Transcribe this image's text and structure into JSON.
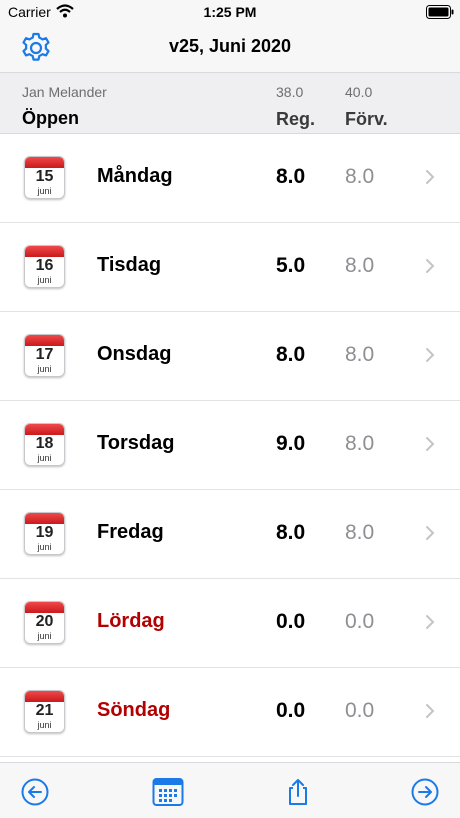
{
  "status_bar": {
    "carrier": "Carrier",
    "time": "1:25 PM"
  },
  "nav": {
    "title": "v25, Juni 2020"
  },
  "header": {
    "user": "Jan Melander",
    "status": "Öppen",
    "reg_total": "38.0",
    "expected_total": "40.0",
    "reg_label": "Reg.",
    "expected_label": "Förv."
  },
  "days": [
    {
      "date": "15",
      "month": "juni",
      "name": "Måndag",
      "reg": "8.0",
      "expected": "8.0",
      "weekend": false
    },
    {
      "date": "16",
      "month": "juni",
      "name": "Tisdag",
      "reg": "5.0",
      "expected": "8.0",
      "weekend": false
    },
    {
      "date": "17",
      "month": "juni",
      "name": "Onsdag",
      "reg": "8.0",
      "expected": "8.0",
      "weekend": false
    },
    {
      "date": "18",
      "month": "juni",
      "name": "Torsdag",
      "reg": "9.0",
      "expected": "8.0",
      "weekend": false
    },
    {
      "date": "19",
      "month": "juni",
      "name": "Fredag",
      "reg": "8.0",
      "expected": "8.0",
      "weekend": false
    },
    {
      "date": "20",
      "month": "juni",
      "name": "Lördag",
      "reg": "0.0",
      "expected": "0.0",
      "weekend": true
    },
    {
      "date": "21",
      "month": "juni",
      "name": "Söndag",
      "reg": "0.0",
      "expected": "0.0",
      "weekend": true
    }
  ],
  "tab_bar": {
    "icons": [
      "arrow-left-circle-icon",
      "calendar-grid-icon",
      "share-icon",
      "arrow-right-circle-icon"
    ]
  },
  "colors": {
    "accent": "#1a7ae8",
    "weekend": "#b30000",
    "calendar_red": "#d92b2d"
  }
}
